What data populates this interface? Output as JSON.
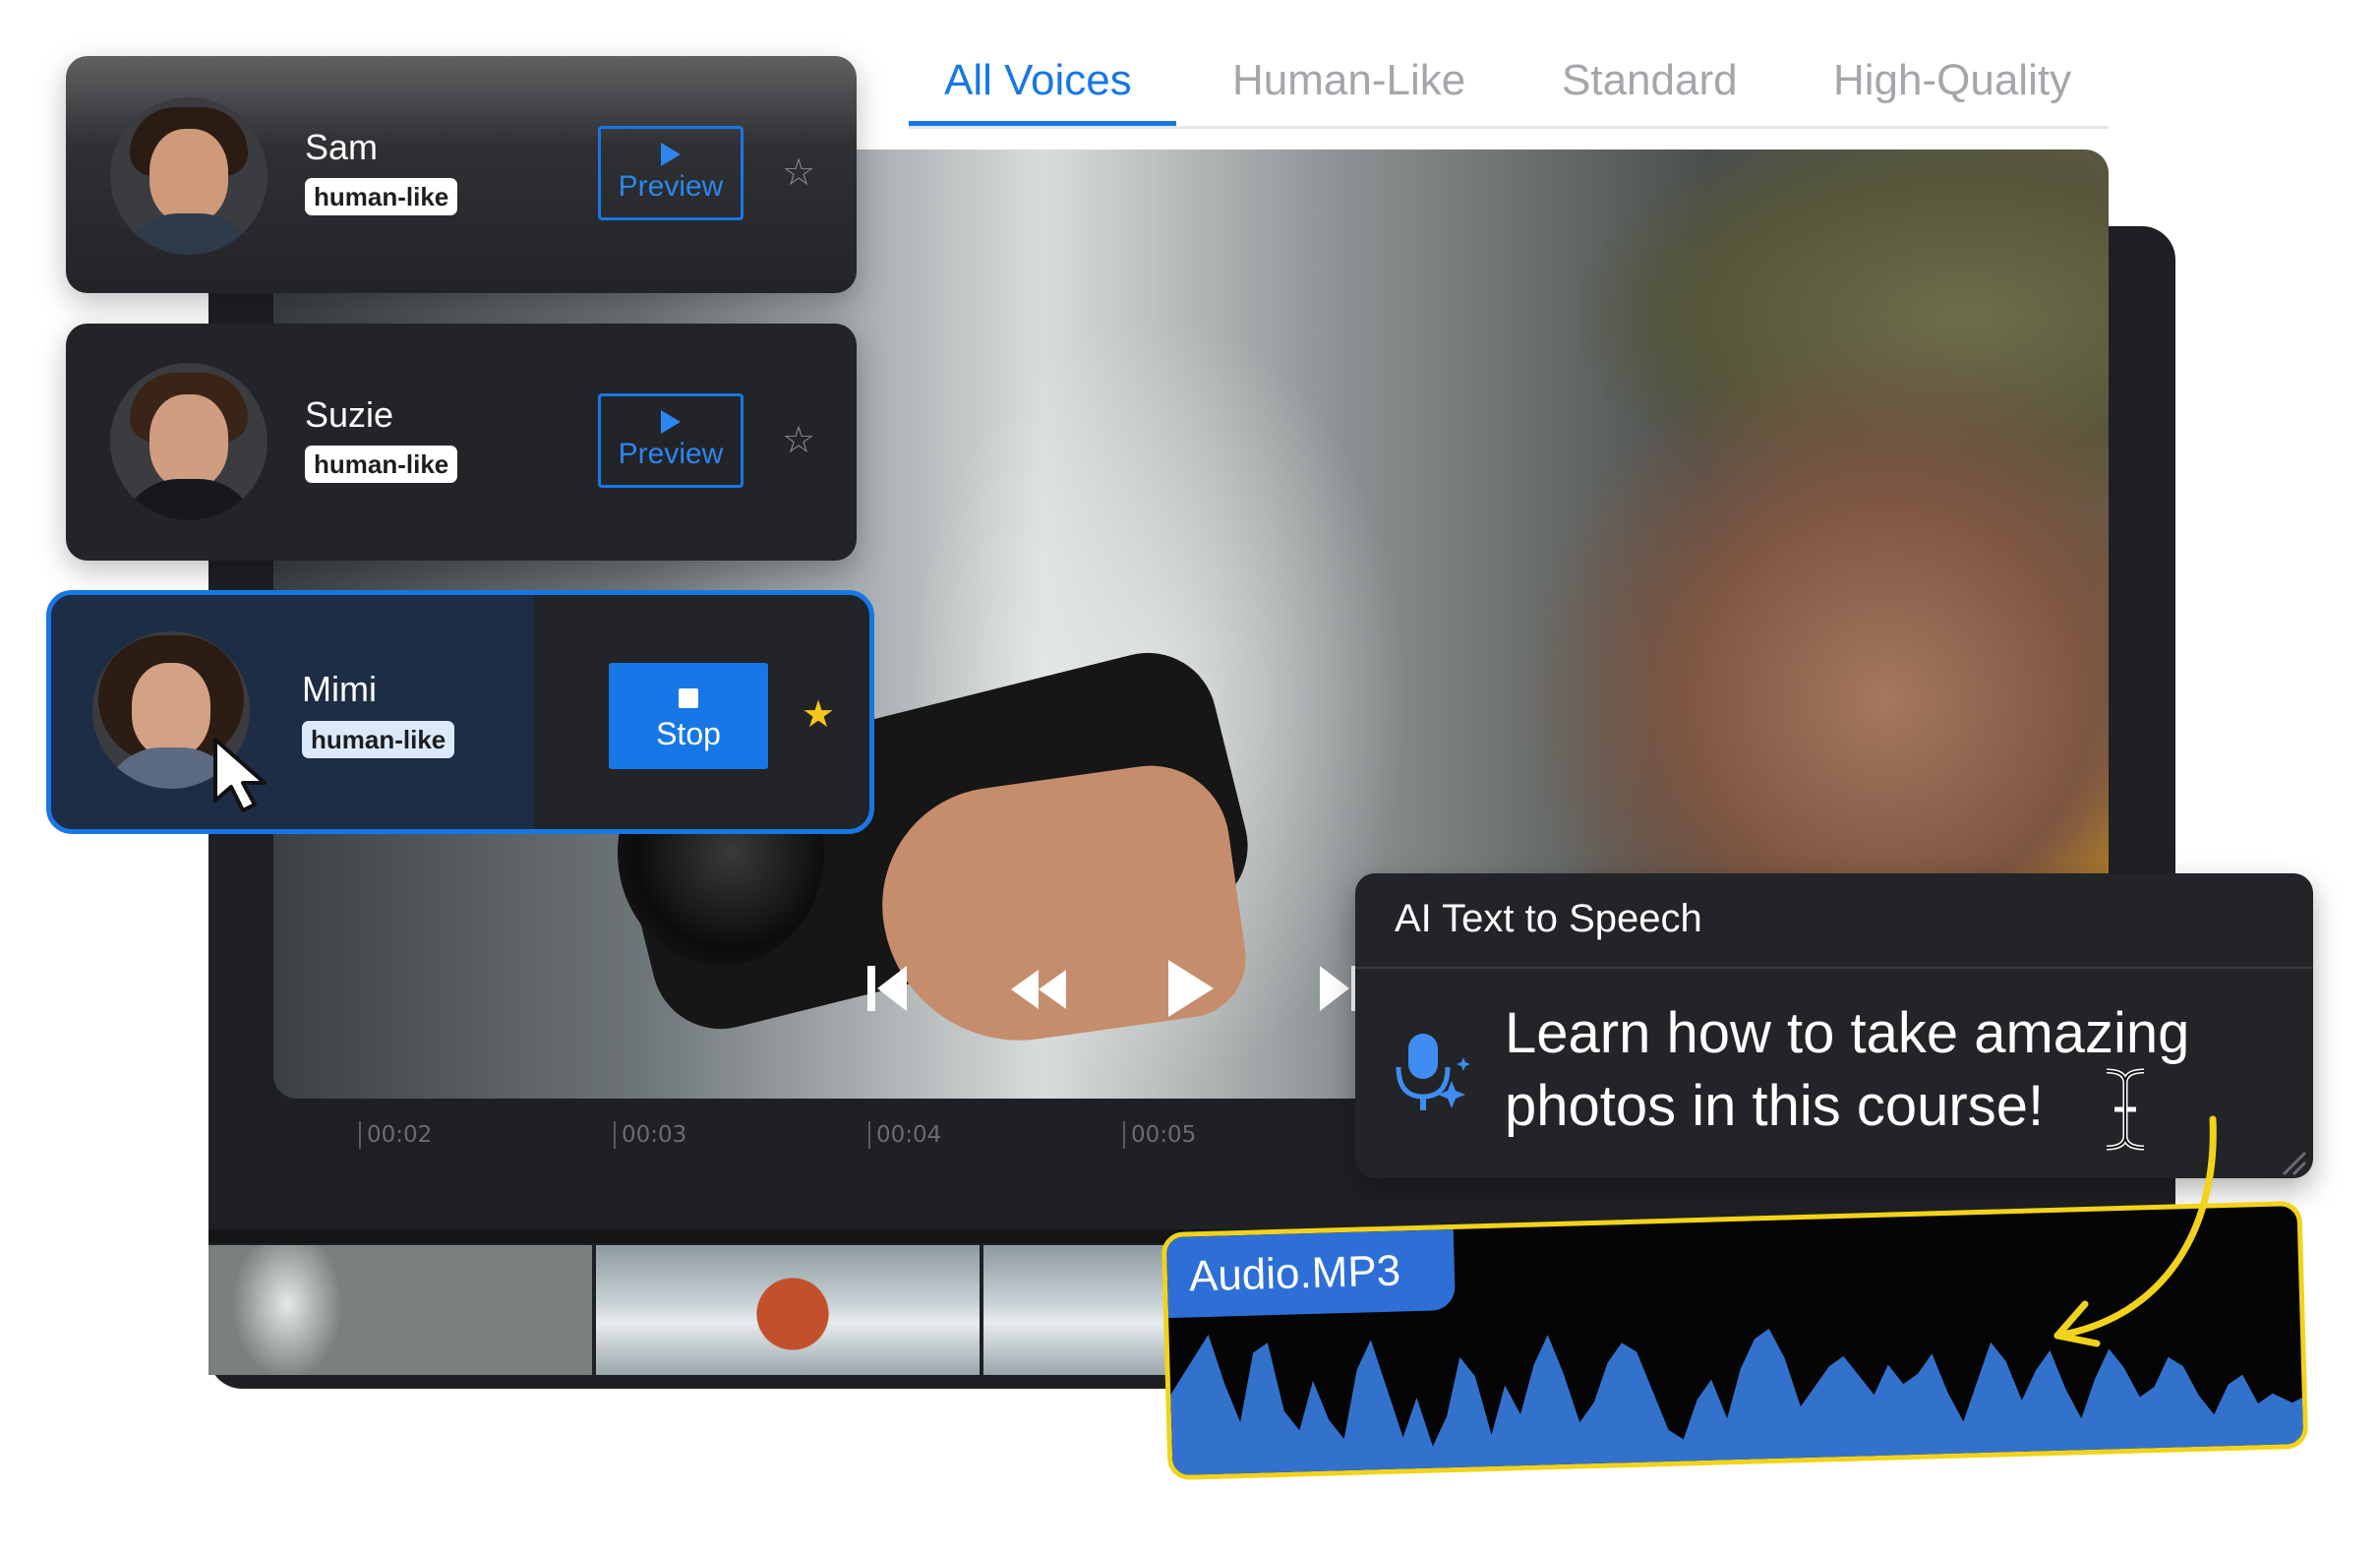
{
  "tabs": {
    "items": [
      {
        "label": "All Voices",
        "active": true
      },
      {
        "label": "Human-Like",
        "active": false
      },
      {
        "label": "Standard",
        "active": false
      },
      {
        "label": "High-Quality",
        "active": false
      }
    ]
  },
  "voices": [
    {
      "name": "Sam",
      "badge": "human-like",
      "button": "Preview",
      "starred": false
    },
    {
      "name": "Suzie",
      "badge": "human-like",
      "button": "Preview",
      "starred": false
    },
    {
      "name": "Mimi",
      "badge": "human-like",
      "button": "Stop",
      "starred": true,
      "selected": true
    }
  ],
  "player": {
    "controls": [
      "skip-back-icon",
      "rewind-icon",
      "play-icon",
      "skip-forward-icon"
    ]
  },
  "timeline": {
    "ticks": [
      "00:02",
      "00:03",
      "00:04",
      "00:05"
    ]
  },
  "tts": {
    "title": "AI Text to Speech",
    "text": "Learn how to take amazing photos in this course!"
  },
  "audio": {
    "label": "Audio.MP3"
  },
  "colors": {
    "accent": "#1777e6",
    "highlight": "#f2d31b",
    "star_active": "#f5c518",
    "panel": "#232427"
  }
}
